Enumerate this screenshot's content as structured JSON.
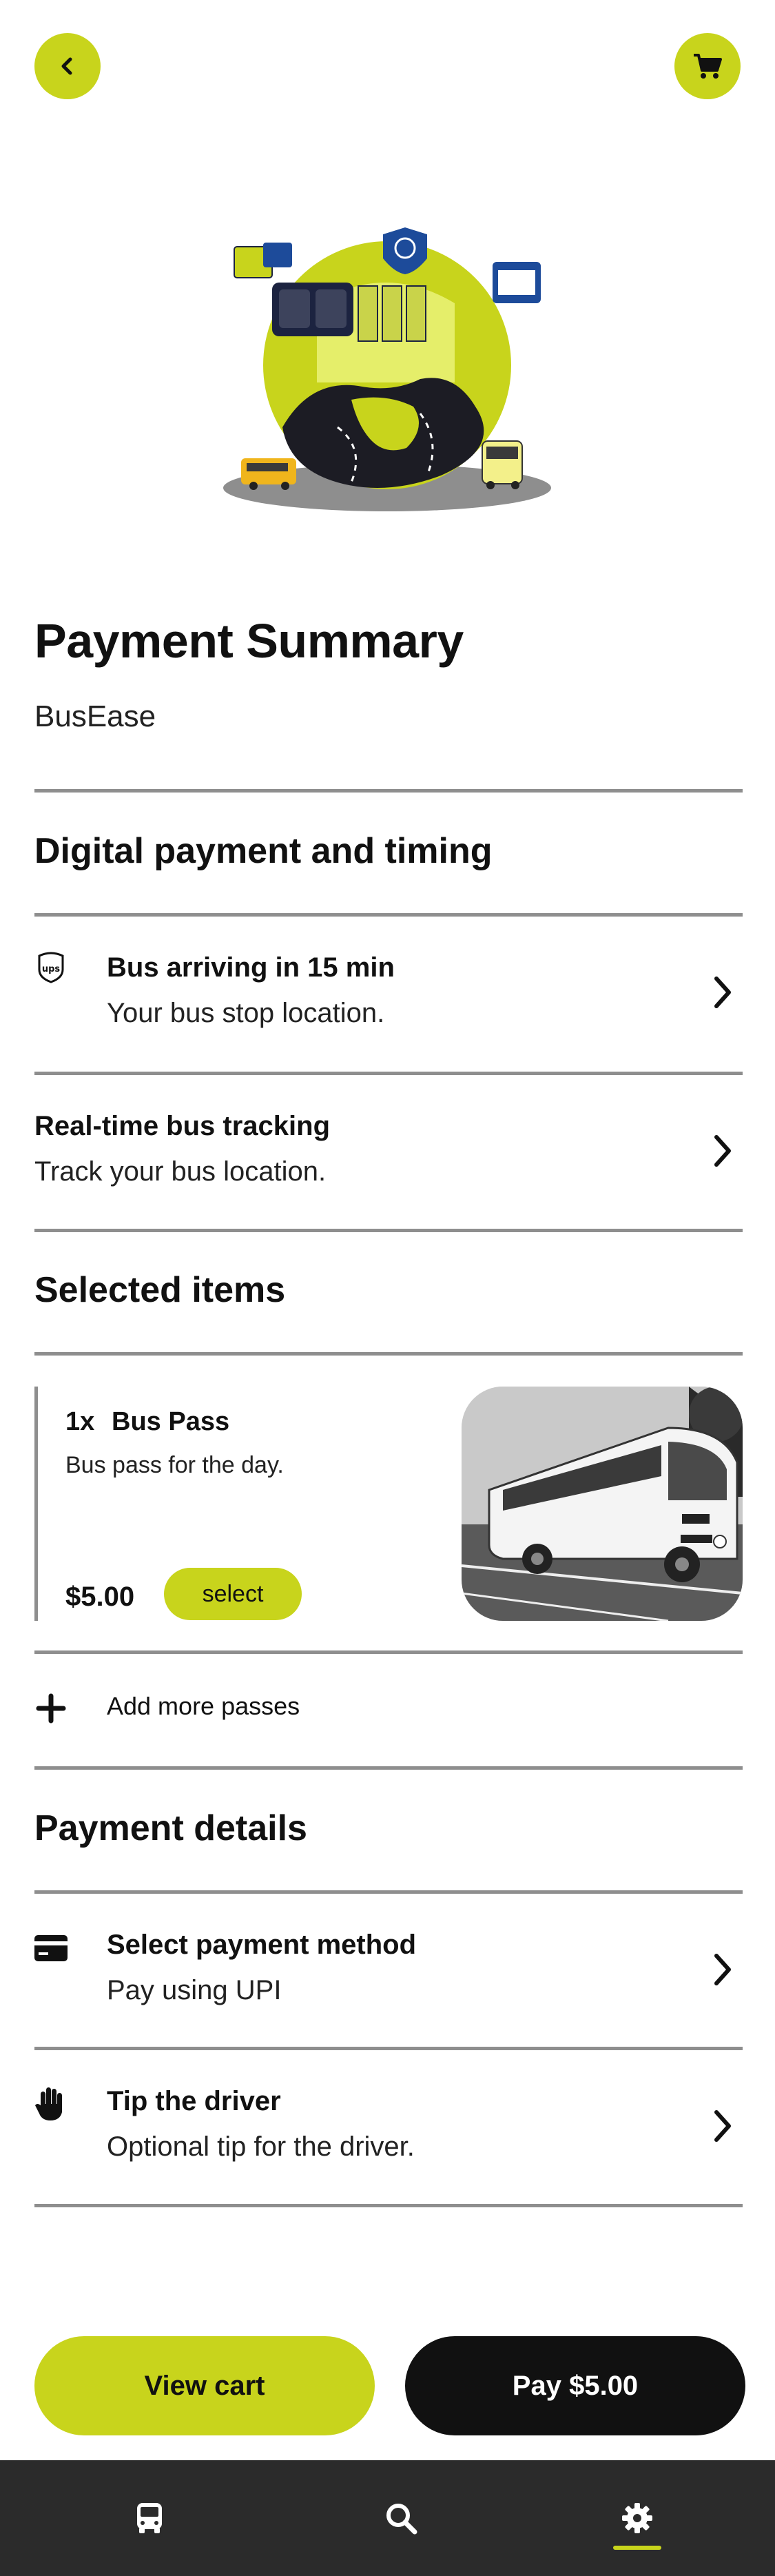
{
  "header": {
    "back_icon": "chevron-left-icon",
    "cart_icon": "cart-icon"
  },
  "page": {
    "title": "Payment Summary",
    "subtitle": "BusEase"
  },
  "digital": {
    "section_title": "Digital payment and timing",
    "arrival": {
      "icon": "ups-icon",
      "title": "Bus arriving in 15 min",
      "subtitle": "Your bus stop location."
    },
    "tracking": {
      "title": "Real-time bus tracking",
      "subtitle": "Track your bus location."
    }
  },
  "selected": {
    "section_title": "Selected items",
    "item": {
      "qty": "1x",
      "name": "Bus Pass",
      "description": "Bus pass for the day.",
      "price": "$5.00",
      "select_label": "select"
    },
    "add_more_label": "Add more passes"
  },
  "payment": {
    "section_title": "Payment details",
    "method": {
      "icon": "credit-card-icon",
      "title": "Select payment method",
      "subtitle": "Pay using UPI"
    },
    "tip": {
      "icon": "hand-icon",
      "title": "Tip the driver",
      "subtitle": "Optional tip for the driver."
    }
  },
  "actions": {
    "view_cart_label": "View cart",
    "pay_label": "Pay $5.00"
  },
  "tabbar": {
    "tabs": [
      {
        "icon": "bus-icon"
      },
      {
        "icon": "search-icon"
      },
      {
        "icon": "gear-icon",
        "active": true
      }
    ]
  },
  "colors": {
    "accent": "#c8d41c",
    "dark": "#111111",
    "tabbar": "#2b2b2b",
    "divider": "#8e8e8e"
  }
}
